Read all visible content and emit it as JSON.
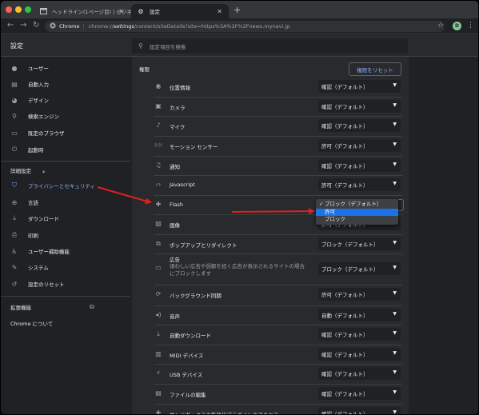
{
  "browser": {
    "tabs": [
      {
        "title": "ヘッドライン(1ページ目) | ビジネ"
      },
      {
        "title": "設定"
      }
    ],
    "url": {
      "label": "Chrome",
      "host": "chrome://",
      "bold": "settings",
      "rest": "/content/siteDetails?site=https%3A%2F%2Fnews.mynavi.jp"
    },
    "profile_initial": "D"
  },
  "settings": {
    "title": "設定",
    "search_placeholder": "設定項目を検索"
  },
  "sidebar": {
    "items": [
      {
        "label": "ユーザー",
        "icon": "person-icon"
      },
      {
        "label": "自動入力",
        "icon": "autofill-icon"
      },
      {
        "label": "デザイン",
        "icon": "palette-icon"
      },
      {
        "label": "検索エンジン",
        "icon": "search-icon"
      },
      {
        "label": "既定のブラウザ",
        "icon": "browser-icon"
      },
      {
        "label": "起動時",
        "icon": "power-icon"
      }
    ],
    "advanced_label": "詳細設定",
    "advanced_items": [
      {
        "label": "プライバシーとセキュリティ",
        "icon": "shield-icon",
        "active": true
      },
      {
        "label": "言語",
        "icon": "globe-icon"
      },
      {
        "label": "ダウンロード",
        "icon": "download-icon"
      },
      {
        "label": "印刷",
        "icon": "print-icon"
      },
      {
        "label": "ユーザー補助機能",
        "icon": "accessibility-icon"
      },
      {
        "label": "システム",
        "icon": "wrench-icon"
      },
      {
        "label": "設定のリセット",
        "icon": "reset-icon"
      }
    ],
    "extensions_label": "拡張機能",
    "about_label": "Chrome について"
  },
  "main": {
    "section_title": "権限",
    "reset_button": "権限をリセット",
    "permissions": [
      {
        "label": "位置情報",
        "icon": "location-icon",
        "value": "確認（デフォルト）"
      },
      {
        "label": "カメラ",
        "icon": "camera-icon",
        "value": "確認（デフォルト）"
      },
      {
        "label": "マイク",
        "icon": "mic-icon",
        "value": "確認（デフォルト）"
      },
      {
        "label": "モーション センサー",
        "icon": "motion-sensor-icon",
        "value": "許可（デフォルト）"
      },
      {
        "label": "通知",
        "icon": "bell-icon",
        "value": "確認（デフォルト）"
      },
      {
        "label": "Javascript",
        "icon": "code-icon",
        "value": "許可（デフォルト）"
      },
      {
        "label": "Flash",
        "icon": "puzzle-icon",
        "value": "ブロック（デフォルト）"
      },
      {
        "label": "画像",
        "icon": "image-icon",
        "value": "許可（デフォルト）"
      },
      {
        "label": "ポップアップとリダイレクト",
        "icon": "popup-icon",
        "value": "ブロック（デフォルト）"
      },
      {
        "label": "広告",
        "icon": "ads-icon",
        "value": "ブロック（デフォルト）",
        "desc1": "煩わしい広告や誤解を招く広告が表示されるサイトの場合",
        "desc2": "にブロックします"
      },
      {
        "label": "バックグラウンド同期",
        "icon": "sync-icon",
        "value": "許可（デフォルト）"
      },
      {
        "label": "音声",
        "icon": "speaker-icon",
        "value": "自動（デフォルト）"
      },
      {
        "label": "自動ダウンロード",
        "icon": "download-icon",
        "value": "確認（デフォルト）"
      },
      {
        "label": "MIDI デバイス",
        "icon": "piano-icon",
        "value": "確認（デフォルト）"
      },
      {
        "label": "USB デバイス",
        "icon": "usb-icon",
        "value": "確認（デフォルト）"
      },
      {
        "label": "ファイルの編集",
        "icon": "file-icon",
        "value": "確認（デフォルト）"
      },
      {
        "label": "サンドボックスの無効化プラグインのアクセス",
        "icon": "puzzle-icon",
        "value": "確認（デフォルト）"
      }
    ],
    "flash_dropdown": {
      "options": [
        "ブロック（デフォルト）",
        "許可",
        "ブロック"
      ],
      "checked_index": 0,
      "highlighted_index": 1
    }
  },
  "colors": {
    "accent": "#8ab4f8",
    "annotation_arrow": "#e02020",
    "highlight": "#1a73e8"
  }
}
